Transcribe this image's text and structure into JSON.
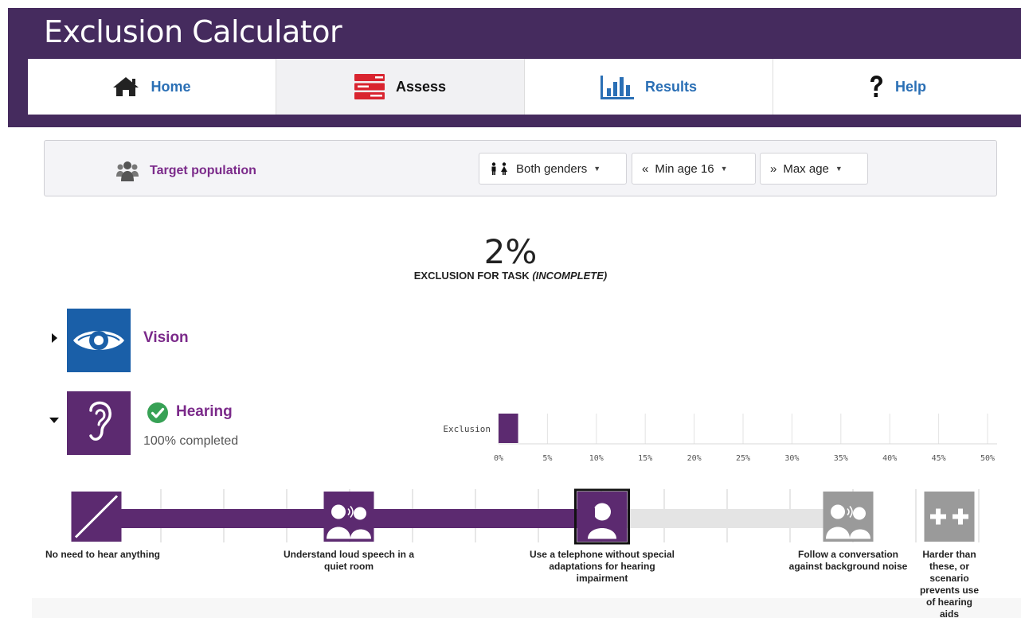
{
  "app": {
    "title": "Exclusion Calculator"
  },
  "nav": {
    "items": [
      {
        "label": "Home",
        "icon": "home-icon"
      },
      {
        "label": "Assess",
        "icon": "assess-icon"
      },
      {
        "label": "Results",
        "icon": "bar-chart-icon"
      },
      {
        "label": "Help",
        "icon": "question-icon"
      }
    ],
    "active": "Assess"
  },
  "target": {
    "label": "Target population",
    "gender": "Both genders",
    "min_age": "Min age 16",
    "max_age": "Max age"
  },
  "summary": {
    "value": "2%",
    "label": "EXCLUSION FOR TASK",
    "status": "(INCOMPLETE)"
  },
  "capabilities": [
    {
      "name": "Vision",
      "expanded": false,
      "color": "#1a5fa8"
    },
    {
      "name": "Hearing",
      "expanded": true,
      "completed": "100% completed",
      "color": "#5c2a70"
    }
  ],
  "chart_data": {
    "type": "bar",
    "orientation": "horizontal",
    "categories": [
      "Exclusion"
    ],
    "values": [
      2
    ],
    "xlim": [
      0,
      50
    ],
    "xticks": [
      "0%",
      "5%",
      "10%",
      "15%",
      "20%",
      "25%",
      "30%",
      "35%",
      "40%",
      "45%",
      "50%"
    ],
    "color": "#5c2a70"
  },
  "hearing_scale": {
    "selected_index": 3,
    "levels": [
      {
        "label": "No need to hear anything"
      },
      {
        "label": "Understand loud speech in a quiet room"
      },
      {
        "label": "Use a telephone without special adaptations for hearing impairment"
      },
      {
        "label": "Follow a conversation against background noise"
      },
      {
        "label": "Harder than these, or scenario prevents use of hearing aids"
      }
    ]
  },
  "colors": {
    "header": "#452b5e",
    "accent": "#7b2a8a",
    "link": "#2a6fb5",
    "scale": "#5c2a70"
  }
}
